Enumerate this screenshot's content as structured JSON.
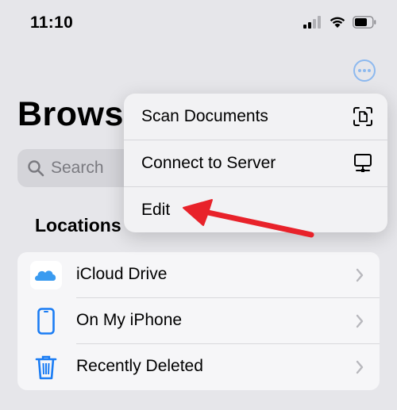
{
  "status_bar": {
    "time": "11:10",
    "icons": [
      "signal-icon",
      "wifi-icon",
      "battery-icon"
    ]
  },
  "header": {
    "title": "Brows",
    "more_icon": "ellipsis-circle-icon"
  },
  "search": {
    "placeholder": "Search",
    "icon": "search-icon"
  },
  "locations": {
    "title": "Locations",
    "items": [
      {
        "label": "iCloud Drive",
        "icon": "icloud-icon"
      },
      {
        "label": "On My iPhone",
        "icon": "iphone-icon"
      },
      {
        "label": "Recently Deleted",
        "icon": "trash-icon"
      }
    ]
  },
  "context_menu": {
    "items": [
      {
        "label": "Scan Documents",
        "icon": "scan-document-icon"
      },
      {
        "label": "Connect to Server",
        "icon": "server-icon"
      },
      {
        "label": "Edit",
        "icon": ""
      }
    ]
  },
  "colors": {
    "accent": "#1a7cf4",
    "annotation_arrow": "#e8222a",
    "chevron": "#b8b8bd"
  }
}
